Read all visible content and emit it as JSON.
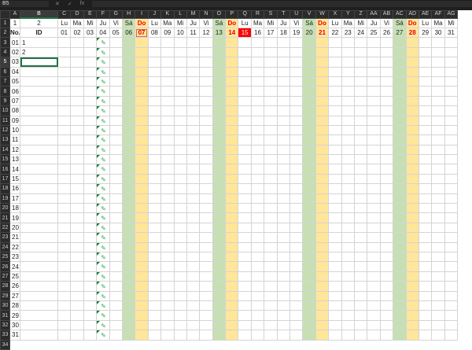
{
  "formula_bar": {
    "name_box": "B5",
    "fx": "fx"
  },
  "columns": [
    "A",
    "B",
    "C",
    "D",
    "E",
    "F",
    "G",
    "H",
    "I",
    "J",
    "K",
    "L",
    "M",
    "N",
    "O",
    "P",
    "Q",
    "R",
    "S",
    "T",
    "U",
    "V",
    "W",
    "X",
    "Y",
    "Z",
    "AA",
    "AB",
    "AC",
    "AD",
    "AE",
    "AF",
    "AG"
  ],
  "row1": {
    "A": "1",
    "B": "2"
  },
  "row2": {
    "A": "No.",
    "B": "ID"
  },
  "weekdays": [
    "Lu",
    "Ma",
    "Mi",
    "Ju",
    "Vi",
    "Sá",
    "Do",
    "Lu",
    "Ma",
    "Mi",
    "Ju",
    "Vi",
    "Sá",
    "Do",
    "Lu",
    "Ma",
    "Mi",
    "Ju",
    "Vi",
    "Sá",
    "Do",
    "Lu",
    "Ma",
    "Mi",
    "Ju",
    "Vi",
    "Sá",
    "Do",
    "Lu",
    "Ma",
    "Mi"
  ],
  "days": [
    "01",
    "02",
    "03",
    "04",
    "05",
    "06",
    "07",
    "08",
    "09",
    "10",
    "11",
    "12",
    "13",
    "14",
    "15",
    "16",
    "17",
    "18",
    "19",
    "20",
    "21",
    "22",
    "23",
    "24",
    "25",
    "26",
    "27",
    "28",
    "29",
    "30",
    "31"
  ],
  "row_numbers": [
    "01",
    "02",
    "03",
    "04",
    "05",
    "06",
    "07",
    "08",
    "09",
    "10",
    "11",
    "12",
    "13",
    "14",
    "15",
    "16",
    "17",
    "18",
    "19",
    "20",
    "21",
    "22",
    "23",
    "24",
    "25",
    "26",
    "27",
    "28",
    "29",
    "30",
    "31"
  ],
  "ids": [
    "1",
    "2"
  ],
  "highlighted_days": {
    "outlined": "07",
    "today": "15"
  },
  "colors": {
    "saturday": "#c6e0b4",
    "sunday": "#ffe699",
    "today": "#ff0000"
  }
}
